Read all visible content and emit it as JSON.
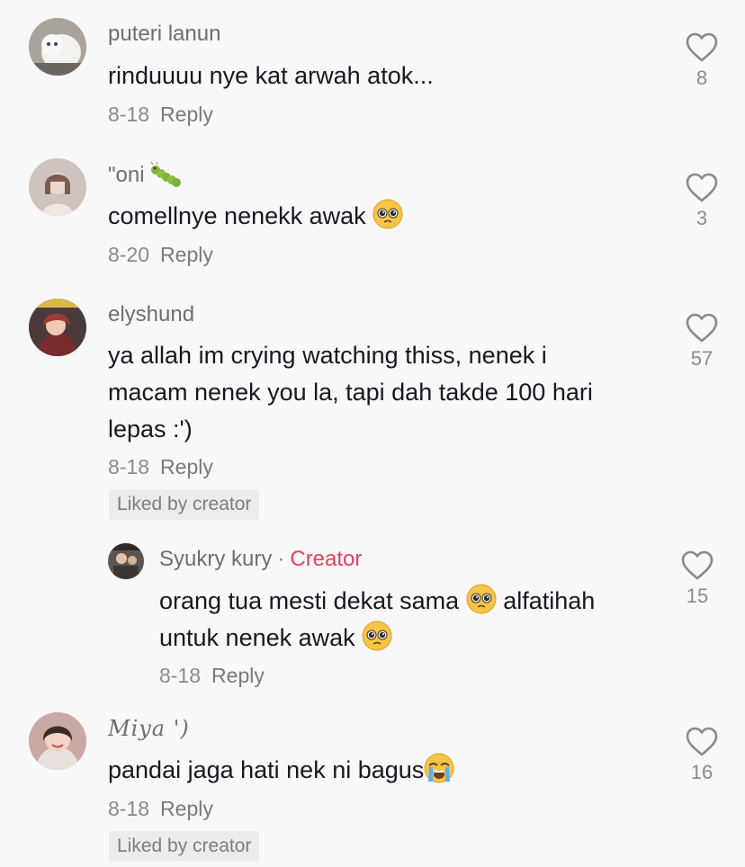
{
  "comments": [
    {
      "username": "puteri lanun",
      "text": "rinduuuu nye kat arwah atok...",
      "date": "8-18",
      "reply_label": "Reply",
      "likes": "8",
      "avatar_icon": "white-cat-avatar"
    },
    {
      "username": "\"oni",
      "username_emoji": "caterpillar-emoji",
      "text": "comellnye nenekk awak",
      "text_emoji": "pleading-face-emoji",
      "date": "8-20",
      "reply_label": "Reply",
      "likes": "3",
      "avatar_icon": "person-avatar"
    },
    {
      "username": "elyshund",
      "text_lines": [
        "ya allah im crying watching thiss, nenek i",
        "macam nenek you la, tapi dah takde 100 hari",
        "lepas :')"
      ],
      "date": "8-18",
      "reply_label": "Reply",
      "liked_by": "Liked by creator",
      "likes": "57",
      "avatar_icon": "anime-avatar"
    },
    {
      "username": "Syukry kury",
      "separator": "·",
      "creator_label": "Creator",
      "text_lines": [
        "orang tua mesti dekat sama",
        "alfatihah",
        "untuk nenek awak"
      ],
      "text_emoji": "pleading-face-emoji",
      "date": "8-18",
      "reply_label": "Reply",
      "likes": "15",
      "avatar_icon": "creator-avatar"
    },
    {
      "username": "Miya ')",
      "text": "pandai jaga hati nek ni bagus",
      "text_emoji": "crying-face-emoji",
      "date": "8-18",
      "reply_label": "Reply",
      "liked_by": "Liked by creator",
      "likes": "16",
      "avatar_icon": "girl-avatar"
    }
  ],
  "colors": {
    "background": "#f8f8f8",
    "text": "#161823",
    "muted": "#8a8a8a",
    "creator": "#e0435f"
  }
}
